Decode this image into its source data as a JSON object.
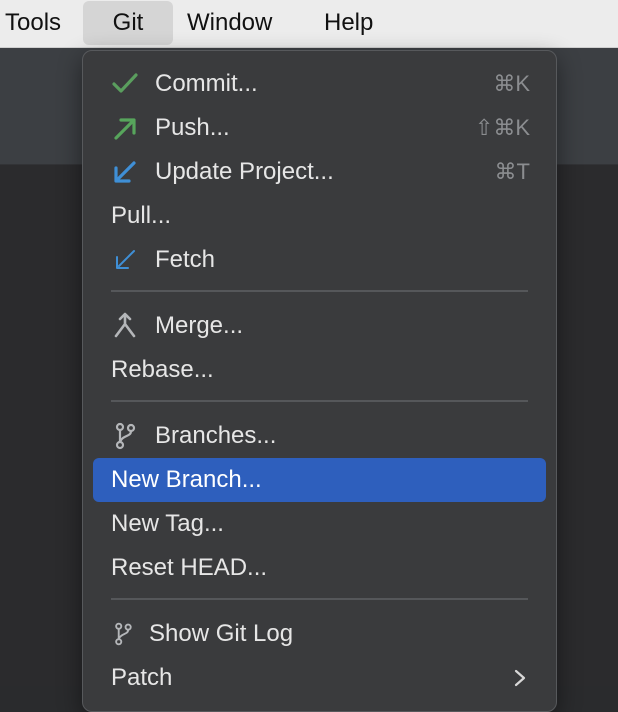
{
  "menubar": {
    "items": [
      {
        "label": "Tools"
      },
      {
        "label": "Git"
      },
      {
        "label": "Window"
      },
      {
        "label": "Help"
      }
    ]
  },
  "git_menu": {
    "commit": {
      "label": "Commit...",
      "shortcut": "⌘K",
      "icon": "check-icon"
    },
    "push": {
      "label": "Push...",
      "shortcut": "⇧⌘K",
      "icon": "push-arrow-icon"
    },
    "update": {
      "label": "Update Project...",
      "shortcut": "⌘T",
      "icon": "update-arrow-icon"
    },
    "pull": {
      "label": "Pull..."
    },
    "fetch": {
      "label": "Fetch",
      "icon": "fetch-arrow-icon"
    },
    "merge": {
      "label": "Merge...",
      "icon": "merge-icon"
    },
    "rebase": {
      "label": "Rebase..."
    },
    "branches": {
      "label": "Branches...",
      "icon": "branch-icon"
    },
    "new_branch": {
      "label": "New Branch..."
    },
    "new_tag": {
      "label": "New Tag..."
    },
    "reset_head": {
      "label": "Reset HEAD..."
    },
    "show_git_log": {
      "label": "Show Git Log",
      "icon": "git-log-icon"
    },
    "patch": {
      "label": "Patch",
      "icon": "chevron-right-icon"
    }
  },
  "colors": {
    "highlight": "#2e5fbd",
    "check_green": "#5a9e5e",
    "push_green": "#57a55c",
    "update_blue": "#3f8fd6"
  }
}
